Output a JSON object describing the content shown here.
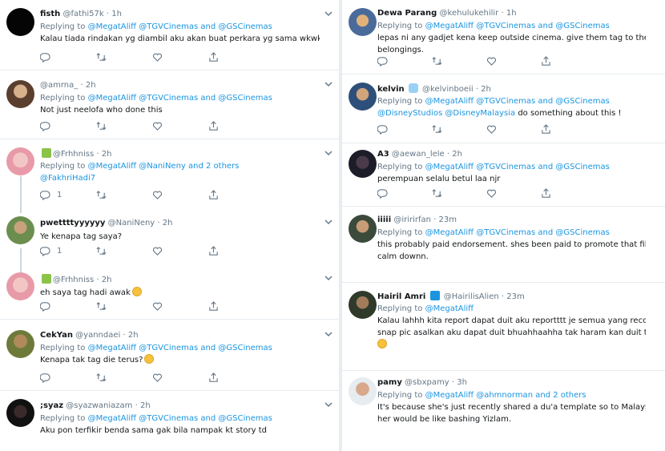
{
  "left": [
    {
      "name": "fisth",
      "handle": "@fathi57k",
      "time": "1h",
      "reply_prefix": "Replying to",
      "reply_targets": "@MegatAliff @TGVCinemas and @GSCinemas",
      "text": [
        "Kalau tiada rindakan yg diambil aku akan buat perkara yg sama wkwkwkw"
      ],
      "reply_count": "",
      "avatar": "black"
    },
    {
      "name": "",
      "handle": "@amrna_",
      "time": "2h",
      "reply_prefix": "Replying to",
      "reply_targets": "@MegatAliff @TGVCinemas and @GSCinemas",
      "text": [
        "Not just neelofa who done this"
      ],
      "reply_count": "",
      "avatar": "woman"
    },
    {
      "name": "",
      "handle": "@Frhhniss",
      "time": "2h",
      "reply_prefix": "Replying to",
      "reply_targets": "@MegatAliff @NaniNeny and 2 others",
      "reply_targets2": "@FakhriHadi7",
      "text": [],
      "reply_count": "1",
      "avatar": "pink"
    },
    {
      "name": "pwettttyyyyyy",
      "handle": "@NaniNeny",
      "time": "2h",
      "text": [
        "Ye kenapa tag saya?"
      ],
      "reply_count": "1",
      "avatar": "outdoor"
    },
    {
      "name": "",
      "handle": "@Frhhniss",
      "time": "2h",
      "text": [
        "eh saya tag hadi awak"
      ],
      "reply_count": "",
      "avatar": "pink"
    },
    {
      "name": "CekYan",
      "handle": "@yanndaei",
      "time": "2h",
      "reply_prefix": "Replying to",
      "reply_targets": "@MegatAliff @TGVCinemas and @GSCinemas",
      "text": [
        "Kenapa tak tag die terus?"
      ],
      "reply_count": "",
      "avatar": "outdoor2"
    },
    {
      "name": ";syaz",
      "handle": "@syazwaniazam",
      "time": "2h",
      "reply_prefix": "Replying to",
      "reply_targets": "@MegatAliff @TGVCinemas and @GSCinemas",
      "text": [
        "Aku pon terfikir benda sama gak bila nampak kt story td"
      ],
      "reply_count": "",
      "avatar": "dark"
    }
  ],
  "right": [
    {
      "name": "Dewa Parang",
      "handle": "@kehulukehilir",
      "time": "1h",
      "reply_prefix": "Replying to",
      "reply_targets": "@MegatAliff @TGVCinemas and @GSCinemas",
      "text": [
        "lepas ni any gadjet kena keep outside cinema. give them tag to their",
        "belongings."
      ],
      "avatar": "anime"
    },
    {
      "name": "kelvin",
      "handle": "@kelvinboeii",
      "time": "2h",
      "reply_prefix": "Replying to",
      "reply_targets": "@MegatAliff @TGVCinemas and @GSCinemas",
      "reply_line2_mentions": "@DisneyStudios @DisneyMalaysia",
      "reply_line2_text": " do something about this !",
      "text": [],
      "avatar": "guy"
    },
    {
      "name": "A3",
      "handle": "@aewan_lele",
      "time": "2h",
      "reply_prefix": "Replying to",
      "reply_targets": "@MegatAliff @TGVCinemas and @GSCinemas",
      "text": [
        "perempuan selalu betul laa njr"
      ],
      "avatar": "dark2"
    },
    {
      "name": "iiiii",
      "handle": "@iririrfan",
      "time": "23m",
      "reply_prefix": "Replying to",
      "reply_targets": "@MegatAliff @TGVCinemas and @GSCinemas",
      "text": [
        "this probably paid endorsement. shes been paid to promote that film laa bro.",
        "calm downn."
      ],
      "avatar": "guy2"
    },
    {
      "name": "Hairil Amri",
      "handle": "@HairilisAlien",
      "time": "23m",
      "reply_prefix": "Replying to",
      "reply_targets": "@MegatAliff",
      "text": [
        "Kalau lahhh kita report dapat duit aku reportttt je semua yang record even",
        "snap pic asalkan aku dapat duit bhuahhaahha tak haram kan duit tu?"
      ],
      "avatar": "guy3"
    },
    {
      "name": "pamy",
      "handle": "@sbxpamy",
      "time": "3h",
      "reply_prefix": "Replying to",
      "reply_targets": "@MegatAliff @ahmnorman and 2 others",
      "text": [
        "It's because she's just recently shared a du'a template so to Malays, bashing",
        "her would be like bashing Yizlam."
      ],
      "avatar": "guy4"
    }
  ],
  "colors": {
    "mention": "#1b95e0",
    "muted": "#657786",
    "divider": "#e6ecf0",
    "text": "#14171a"
  }
}
